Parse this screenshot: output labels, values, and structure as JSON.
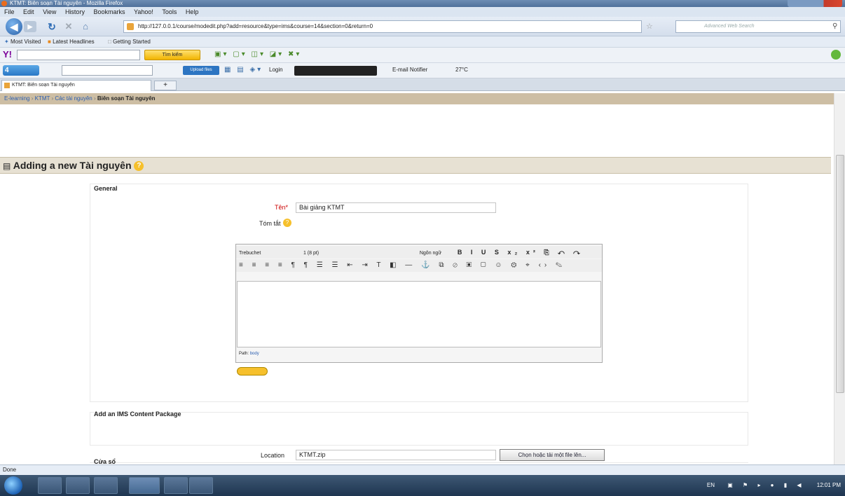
{
  "window": {
    "title": "KTMT: Biên soạn Tài nguyên - Mozilla Firefox"
  },
  "menu": [
    "File",
    "Edit",
    "View",
    "History",
    "Bookmarks",
    "Yahoo!",
    "Tools",
    "Help"
  ],
  "nav": {
    "url": "http://127.0.0.1/course/modedit.php?add=resource&type=ims&course=14&section=0&return=0",
    "search_placeholder": "Advanced Web Search"
  },
  "bookmarks": [
    "Most Visited",
    "Latest Headlines",
    "Getting Started"
  ],
  "toolbar1": {
    "search_button": "Tìm kiếm"
  },
  "toolbar2": {
    "upload": "Upload files",
    "login": "Login",
    "email": "E-mail Notifier",
    "weather": "27°C"
  },
  "tab": {
    "title": "KTMT: Biên soạn Tài nguyên"
  },
  "breadcrumb": {
    "items": [
      "E-learning",
      "KTMT",
      "Các tài nguyên",
      "Biên soạn Tài nguyên"
    ]
  },
  "page": {
    "heading": "Adding a new Tài nguyên"
  },
  "general": {
    "legend": "General",
    "name_label": "Tên*",
    "name_value": "Bài giảng KTMT",
    "summary_label": "Tóm tắt"
  },
  "editor": {
    "font": "Trebuchet",
    "size": "1 (8 pt)",
    "style": "",
    "lang": "Ngôn ngữ",
    "path_label": "Path:",
    "path_value": "body"
  },
  "ims": {
    "legend": "Add an IMS Content Package",
    "location_label": "Location",
    "location_value": "KTMT.zip",
    "choose_button": "Chọn hoặc tải một file lên..."
  },
  "next_section": {
    "legend": "Cửa sổ"
  },
  "status": {
    "text": "Done"
  },
  "tray": {
    "lang": "EN",
    "time": "12:01 PM"
  }
}
